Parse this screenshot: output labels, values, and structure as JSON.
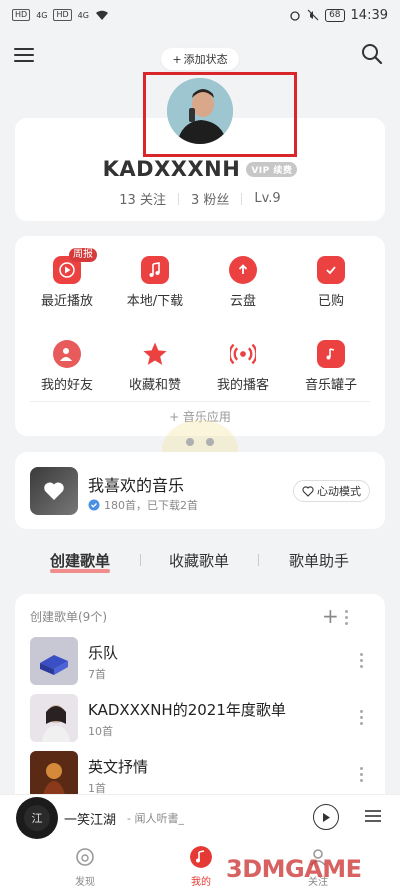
{
  "status_bar": {
    "sim1": "HD",
    "sim2": "HD",
    "net1": "4G",
    "net2": "4G",
    "battery": "68",
    "time": "14:39"
  },
  "header": {
    "add_status": "添加状态"
  },
  "profile": {
    "username": "KADXXXNH",
    "vip_badge": "VIP 续费",
    "following": "13 关注",
    "followers": "3 粉丝",
    "level": "Lv.9"
  },
  "grid": {
    "weekly_badge": "周报",
    "items": [
      {
        "label": "最近播放",
        "icon": "play-circle-icon"
      },
      {
        "label": "本地/下载",
        "icon": "music-note-icon"
      },
      {
        "label": "云盘",
        "icon": "cloud-upload-icon"
      },
      {
        "label": "已购",
        "icon": "purchased-bag-icon"
      },
      {
        "label": "我的好友",
        "icon": "friends-icon"
      },
      {
        "label": "收藏和赞",
        "icon": "star-icon"
      },
      {
        "label": "我的播客",
        "icon": "podcast-icon"
      },
      {
        "label": "音乐罐子",
        "icon": "music-jar-icon"
      }
    ],
    "music_app": "+ 音乐应用"
  },
  "favorite": {
    "title": "我喜欢的音乐",
    "subtitle": "180首，已下载2首",
    "heart_mode": "心动模式"
  },
  "tabs": [
    "创建歌单",
    "收藏歌单",
    "歌单助手"
  ],
  "playlists": {
    "header": "创建歌单(9个)",
    "items": [
      {
        "name": "乐队",
        "count": "7首"
      },
      {
        "name": "KADXXXNH的2021年度歌单",
        "count": "10首"
      },
      {
        "name": "英文抒情",
        "count": "1首"
      }
    ]
  },
  "player": {
    "title": "一笑江湖",
    "artist": "- 闻人听書_"
  },
  "nav": {
    "discover": "发现",
    "mine": "我的",
    "follow": "关注"
  },
  "watermark": "3DMGAME",
  "colors": {
    "accent": "#ec4141",
    "highlight_box": "#d8262b",
    "background": "#f2f3f5"
  }
}
